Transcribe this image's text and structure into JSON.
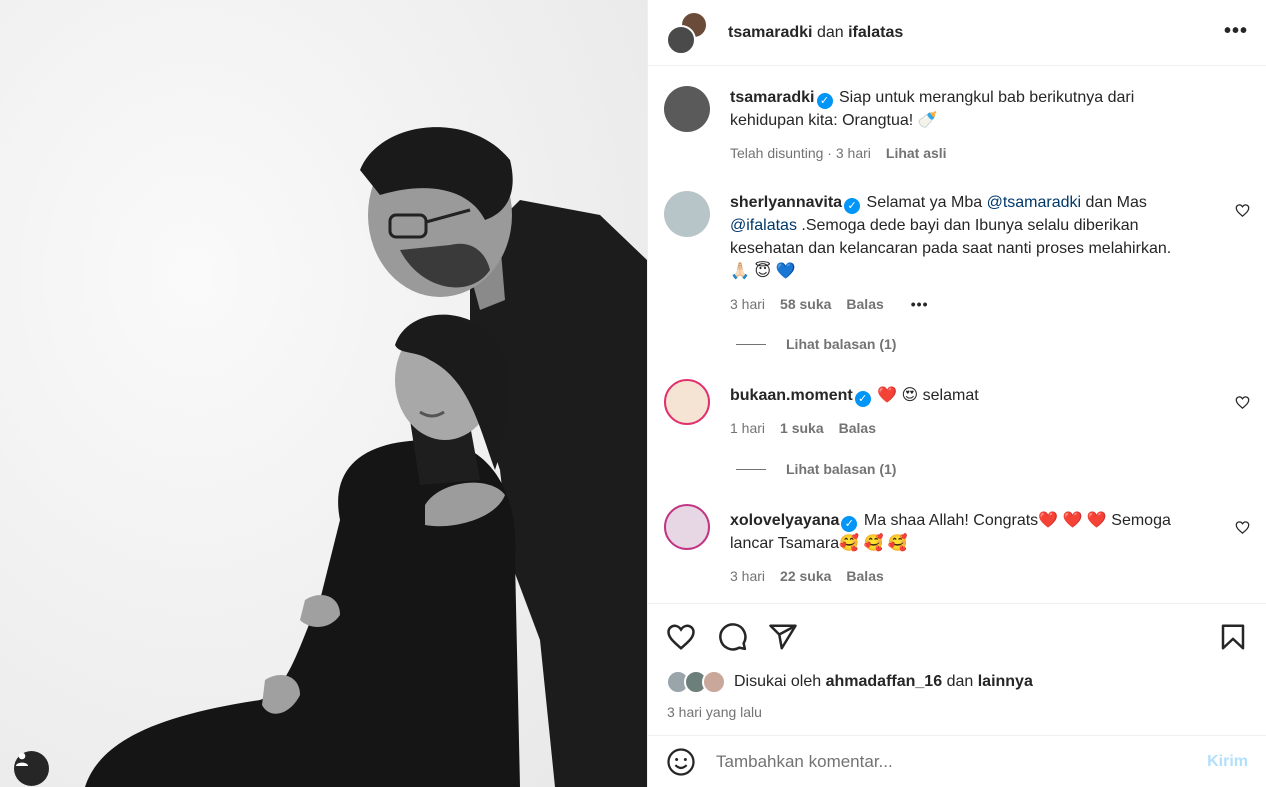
{
  "header": {
    "user1": "tsamaradki",
    "connector": "dan",
    "user2": "ifalatas",
    "more_icon": "more-horizontal-icon"
  },
  "caption": {
    "username": "tsamaradki",
    "text": "Siap untuk merangkul bab berikutnya dari kehidupan kita: Orangtua! 🍼",
    "edited": "Telah disunting",
    "time": "3 hari",
    "translate": "Lihat asli"
  },
  "comments": [
    {
      "username": "sherlyannavita",
      "text_a": "Selamat ya Mba ",
      "mention1": "@tsamaradki",
      "text_b": " dan Mas ",
      "mention2": "@ifalatas",
      "text_c": " .Semoga dede bayi dan Ibunya selalu diberikan kesehatan dan kelancaran pada saat nanti proses melahirkan.",
      "emoji": "🙏🏻 😇 💙",
      "time": "3 hari",
      "likes": "58 suka",
      "reply": "Balas",
      "view_replies": "Lihat balasan (1)"
    },
    {
      "username": "bukaan.moment",
      "text": "❤️ 😍 selamat",
      "time": "1 hari",
      "likes": "1 suka",
      "reply": "Balas",
      "view_replies": "Lihat balasan (1)"
    },
    {
      "username": "xolovelyayana",
      "text": "Ma shaa Allah! Congrats❤️ ❤️ ❤️ Semoga lancar Tsamara🥰 🥰 🥰",
      "time": "3 hari",
      "likes": "22 suka",
      "reply": "Balas"
    }
  ],
  "likes": {
    "prefix": "Disukai oleh",
    "user": "ahmadaffan_16",
    "connector": "dan",
    "others": "lainnya"
  },
  "time_ago": "3 hari yang lalu",
  "add_comment": {
    "placeholder": "Tambahkan komentar...",
    "send_label": "Kirim"
  },
  "colors": {
    "accent": "#0095f6",
    "mention": "#00376b",
    "muted": "#737373",
    "send_disabled": "#b2dffc"
  }
}
